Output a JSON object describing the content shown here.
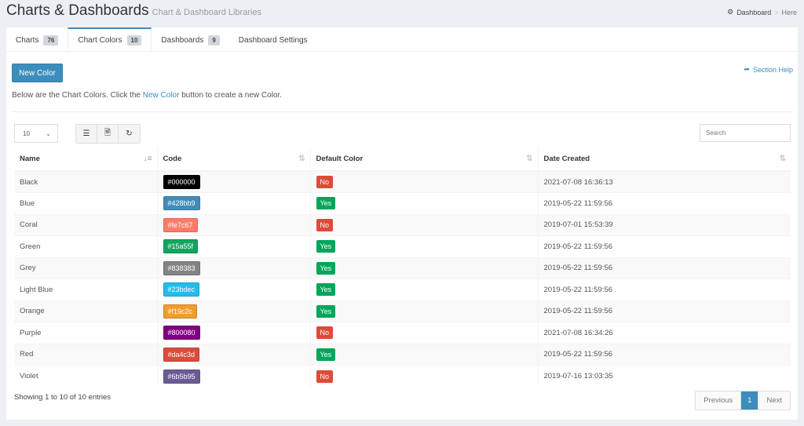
{
  "header": {
    "title": "Charts & Dashboards",
    "subtitle": "Chart & Dashboard Libraries"
  },
  "breadcrumb": {
    "home": "Dashboard",
    "separator": ">",
    "current": "Here"
  },
  "tabs": [
    {
      "label": "Charts",
      "count": "76"
    },
    {
      "label": "Chart Colors",
      "count": "10"
    },
    {
      "label": "Dashboards",
      "count": "9"
    },
    {
      "label": "Dashboard Settings"
    }
  ],
  "toolbar": {
    "new_label": "New Color",
    "help_label": "Section Help"
  },
  "intro": {
    "before": "Below are the Chart Colors. Click the ",
    "link": "New Color",
    "after": " button to create a new Color."
  },
  "table_controls": {
    "page_length": "10",
    "search_placeholder": "Search"
  },
  "table": {
    "columns": [
      "Name",
      "Code",
      "Default Color",
      "Date Created"
    ],
    "rows": [
      {
        "name": "Black",
        "code": "#000000",
        "default": "No",
        "date": "2021-07-08 16:36:13"
      },
      {
        "name": "Blue",
        "code": "#428bb9",
        "default": "Yes",
        "date": "2019-05-22 11:59:56"
      },
      {
        "name": "Coral",
        "code": "#fe7c67",
        "default": "No",
        "date": "2019-07-01 15:53:39"
      },
      {
        "name": "Green",
        "code": "#15a55f",
        "default": "Yes",
        "date": "2019-05-22 11:59:56"
      },
      {
        "name": "Grey",
        "code": "#838383",
        "default": "Yes",
        "date": "2019-05-22 11:59:56"
      },
      {
        "name": "Light Blue",
        "code": "#23bdec",
        "default": "Yes",
        "date": "2019-05-22 11:59:56"
      },
      {
        "name": "Orange",
        "code": "#f19c2c",
        "default": "Yes",
        "date": "2019-05-22 11:59:56"
      },
      {
        "name": "Purple",
        "code": "#800080",
        "default": "No",
        "date": "2021-07-08 16:34:26"
      },
      {
        "name": "Red",
        "code": "#da4c3d",
        "default": "Yes",
        "date": "2019-05-22 11:59:56"
      },
      {
        "name": "Violet",
        "code": "#6b5b95",
        "default": "No",
        "date": "2019-07-16 13:03:35"
      }
    ]
  },
  "footer": {
    "info": "Showing 1 to 10 of 10 entries",
    "prev": "Previous",
    "page": "1",
    "next": "Next"
  },
  "colors": {
    "accent": "#3c8dbc",
    "yes": "#00a65a",
    "no": "#dd4b39"
  }
}
